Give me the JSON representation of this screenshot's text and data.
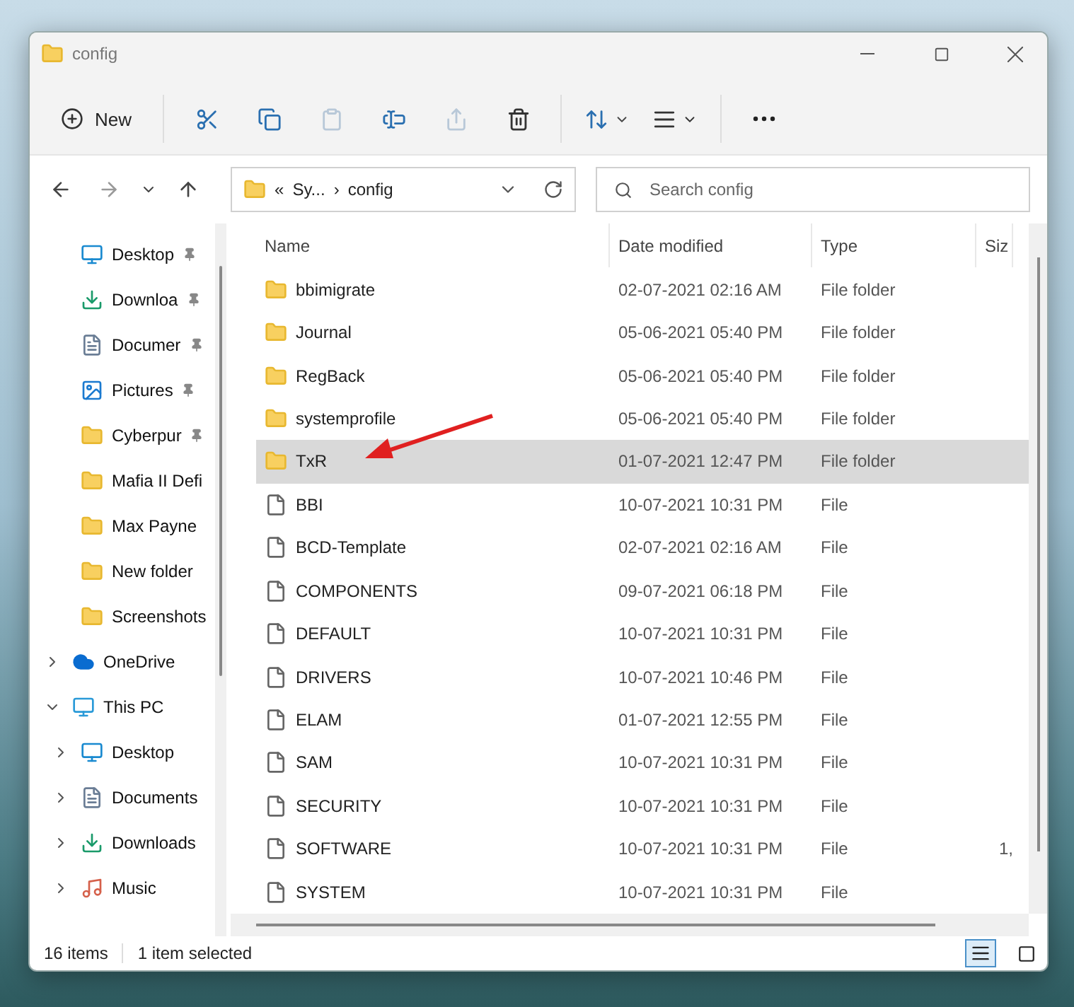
{
  "window": {
    "title": "config"
  },
  "toolbar": {
    "new_label": "New"
  },
  "address": {
    "path": [
      "«",
      "Sy...",
      "›",
      "config"
    ],
    "search_placeholder": "Search config"
  },
  "sidebar": {
    "items": [
      {
        "label": "Desktop",
        "kind": "desktop",
        "pinned": true
      },
      {
        "label": "Downloa",
        "kind": "download",
        "pinned": true
      },
      {
        "label": "Documer",
        "kind": "document",
        "pinned": true
      },
      {
        "label": "Pictures",
        "kind": "pictures",
        "pinned": true
      },
      {
        "label": "Cyberpur",
        "kind": "folder",
        "pinned": true
      },
      {
        "label": "Mafia II  Defi",
        "kind": "folder",
        "pinned": false
      },
      {
        "label": "Max Payne",
        "kind": "folder",
        "pinned": false
      },
      {
        "label": "New folder",
        "kind": "folder",
        "pinned": false
      },
      {
        "label": "Screenshots",
        "kind": "folder",
        "pinned": false
      }
    ],
    "roots": [
      {
        "label": "OneDrive",
        "kind": "cloud",
        "expanded": false
      },
      {
        "label": "This PC",
        "kind": "pc",
        "expanded": true,
        "children": [
          {
            "label": "Desktop",
            "kind": "desktop",
            "expanded": false
          },
          {
            "label": "Documents",
            "kind": "document",
            "expanded": false
          },
          {
            "label": "Downloads",
            "kind": "download",
            "expanded": false
          },
          {
            "label": "Music",
            "kind": "music",
            "expanded": false
          }
        ]
      }
    ]
  },
  "table": {
    "columns": [
      "Name",
      "Date modified",
      "Type",
      "Siz"
    ],
    "rows": [
      {
        "name": "bbimigrate",
        "date": "02-07-2021 02:16 AM",
        "type": "File folder",
        "kind": "folder",
        "selected": false
      },
      {
        "name": "Journal",
        "date": "05-06-2021 05:40 PM",
        "type": "File folder",
        "kind": "folder",
        "selected": false
      },
      {
        "name": "RegBack",
        "date": "05-06-2021 05:40 PM",
        "type": "File folder",
        "kind": "folder",
        "selected": false
      },
      {
        "name": "systemprofile",
        "date": "05-06-2021 05:40 PM",
        "type": "File folder",
        "kind": "folder",
        "selected": false
      },
      {
        "name": "TxR",
        "date": "01-07-2021 12:47 PM",
        "type": "File folder",
        "kind": "folder",
        "selected": true
      },
      {
        "name": "BBI",
        "date": "10-07-2021 10:31 PM",
        "type": "File",
        "kind": "file",
        "selected": false
      },
      {
        "name": "BCD-Template",
        "date": "02-07-2021 02:16 AM",
        "type": "File",
        "kind": "file",
        "selected": false
      },
      {
        "name": "COMPONENTS",
        "date": "09-07-2021 06:18 PM",
        "type": "File",
        "kind": "file",
        "selected": false
      },
      {
        "name": "DEFAULT",
        "date": "10-07-2021 10:31 PM",
        "type": "File",
        "kind": "file",
        "selected": false
      },
      {
        "name": "DRIVERS",
        "date": "10-07-2021 10:46 PM",
        "type": "File",
        "kind": "file",
        "selected": false
      },
      {
        "name": "ELAM",
        "date": "01-07-2021 12:55 PM",
        "type": "File",
        "kind": "file",
        "selected": false
      },
      {
        "name": "SAM",
        "date": "10-07-2021 10:31 PM",
        "type": "File",
        "kind": "file",
        "selected": false
      },
      {
        "name": "SECURITY",
        "date": "10-07-2021 10:31 PM",
        "type": "File",
        "kind": "file",
        "selected": false
      },
      {
        "name": "SOFTWARE",
        "date": "10-07-2021 10:31 PM",
        "type": "File",
        "kind": "file",
        "size": "1,",
        "selected": false
      },
      {
        "name": "SYSTEM",
        "date": "10-07-2021 10:31 PM",
        "type": "File",
        "kind": "file",
        "selected": false
      }
    ]
  },
  "status_bar": {
    "count": "16 items",
    "selection": "1 item selected"
  }
}
